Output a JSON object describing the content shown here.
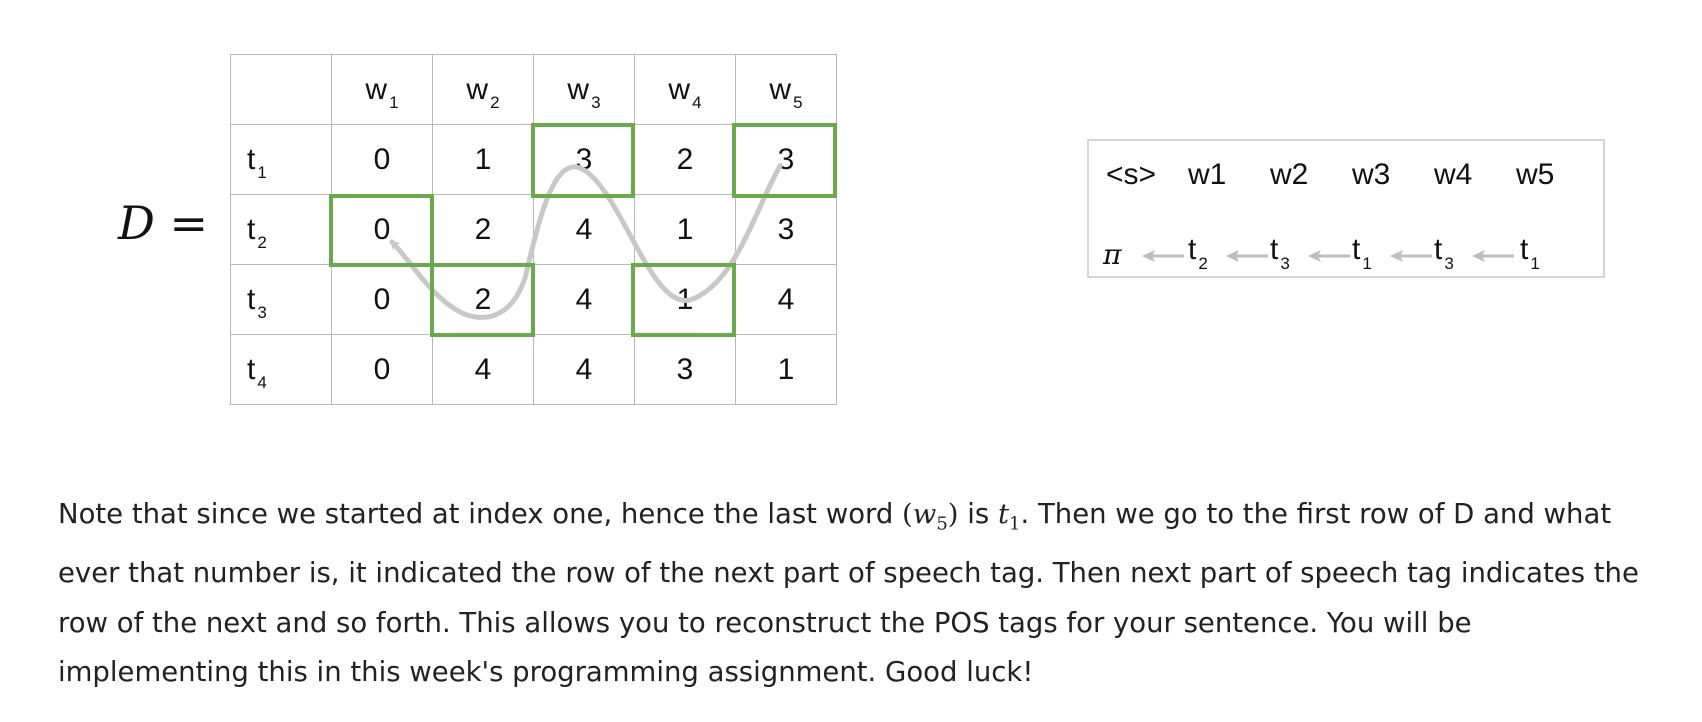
{
  "d_label": {
    "symbol": "D",
    "equals": "="
  },
  "matrix": {
    "col_headers": [
      {
        "base": "w",
        "sub": "1"
      },
      {
        "base": "w",
        "sub": "2"
      },
      {
        "base": "w",
        "sub": "3"
      },
      {
        "base": "w",
        "sub": "4"
      },
      {
        "base": "w",
        "sub": "5"
      }
    ],
    "rows": [
      {
        "base": "t",
        "sub": "1",
        "values": [
          "0",
          "1",
          "3",
          "2",
          "3"
        ]
      },
      {
        "base": "t",
        "sub": "2",
        "values": [
          "0",
          "2",
          "4",
          "1",
          "3"
        ]
      },
      {
        "base": "t",
        "sub": "3",
        "values": [
          "0",
          "2",
          "4",
          "1",
          "4"
        ]
      },
      {
        "base": "t",
        "sub": "4",
        "values": [
          "0",
          "4",
          "4",
          "3",
          "1"
        ]
      }
    ],
    "highlighted_cells": [
      [
        1,
        0
      ],
      [
        2,
        1
      ],
      [
        0,
        2
      ],
      [
        2,
        3
      ],
      [
        0,
        4
      ]
    ],
    "highlight_color": "#6aaa4e",
    "path_color": "#c8c8c8"
  },
  "backtrace": {
    "words": [
      "<s>",
      "w1",
      "w2",
      "w3",
      "w4",
      "w5"
    ],
    "pi": "π",
    "tags": [
      {
        "base": "t",
        "sub": "2"
      },
      {
        "base": "t",
        "sub": "3"
      },
      {
        "base": "t",
        "sub": "1"
      },
      {
        "base": "t",
        "sub": "3"
      },
      {
        "base": "t",
        "sub": "1"
      }
    ],
    "arrow_color": "#bdbdbd"
  },
  "note": {
    "part1": "Note that since we started at index one, hence the last word ",
    "math1_open": "(",
    "math1_var": "w",
    "math1_sub": "5",
    "math1_close": ")",
    "part2": " is ",
    "math2_var": "t",
    "math2_sub": "1",
    "part3": ". Then we go to the first row of D and what ever that number is, it indicated the row of the next part of speech tag. Then next part of speech tag indicates the row of the next and so forth. This allows you to reconstruct the POS tags for your sentence. You will be implementing this in this week's programming assignment. Good luck!"
  }
}
